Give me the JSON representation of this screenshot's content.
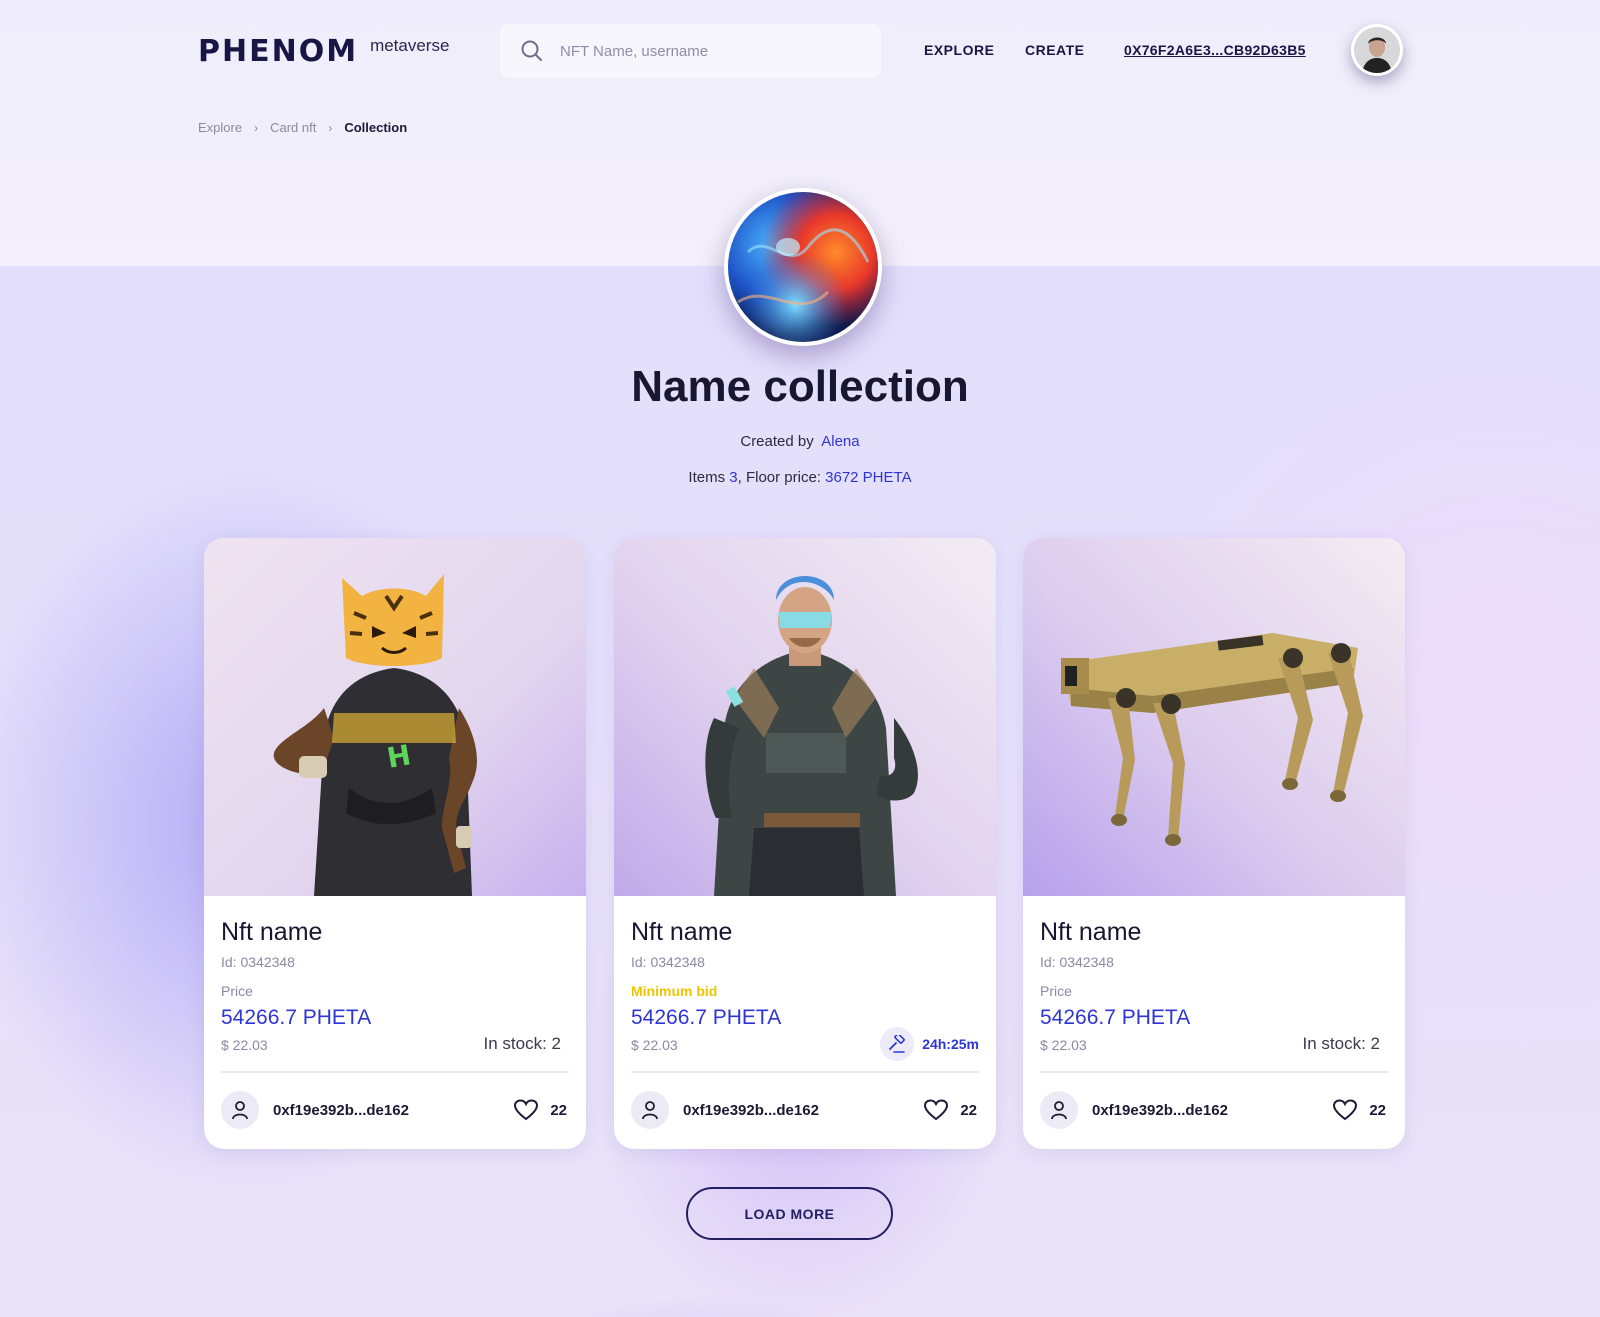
{
  "header": {
    "logo_main": "PHENOM",
    "logo_sub": "metaverse",
    "search_placeholder": "NFT Name, username",
    "nav_explore": "EXPLORE",
    "nav_create": "CREATE",
    "wallet": "0X76F2A6E3...CB92D63B5"
  },
  "breadcrumb": {
    "items": [
      "Explore",
      "Card nft",
      "Collection"
    ]
  },
  "collection": {
    "title": "Name collection",
    "created_by_label": "Created by",
    "creator": "Alena",
    "items_label": "Items",
    "items_count": "3",
    "floor_label": ", Floor price:",
    "floor_price": "3672 PHETA"
  },
  "cards": [
    {
      "name": "Nft name",
      "id": "Id: 0342348",
      "price_label": "Price",
      "price": "54266.7 PHETA",
      "usd": "$ 22.03",
      "stock": "In stock: 2",
      "owner": "0xf19e392b...de162",
      "likes": "22"
    },
    {
      "name": "Nft name",
      "id": "Id: 0342348",
      "price_label": "Minimum bid",
      "price": "54266.7 PHETA",
      "usd": "$ 22.03",
      "timer": "24h:25m",
      "owner": "0xf19e392b...de162",
      "likes": "22"
    },
    {
      "name": "Nft name",
      "id": "Id: 0342348",
      "price_label": "Price",
      "price": "54266.7 PHETA",
      "usd": "$ 22.03",
      "stock": "In stock: 2",
      "owner": "0xf19e392b...de162",
      "likes": "22"
    }
  ],
  "load_more": "LOAD MORE",
  "colors": {
    "accent_blue": "#2e35d6",
    "bid_yellow": "#f0c400",
    "navy": "#181645"
  }
}
